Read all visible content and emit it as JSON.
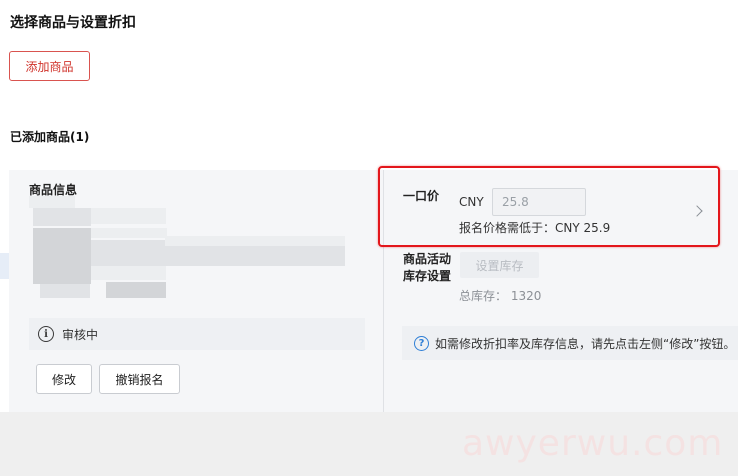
{
  "page": {
    "title": "选择商品与设置折扣",
    "add_button": "添加商品",
    "added_title": "已添加商品(1)"
  },
  "product": {
    "info_label": "商品信息",
    "status": "审核中",
    "edit_button": "修改",
    "withdraw_button": "撤销报名"
  },
  "pricing": {
    "label": "一口价",
    "currency": "CNY",
    "price_value": "25.8",
    "hint": "报名价格需低于：CNY 25.9"
  },
  "stock": {
    "label": "商品活动\n库存设置",
    "set_button": "设置库存",
    "total": "总库存： 1320"
  },
  "notice": {
    "text": "如需修改折扣率及库存信息，请先点击左侧“修改”按钮。"
  },
  "watermark": "awyerwu.com",
  "colors": {
    "accent_red": "#d0342c",
    "highlight_red": "#e3161b",
    "info_blue": "#2f7fd6"
  }
}
